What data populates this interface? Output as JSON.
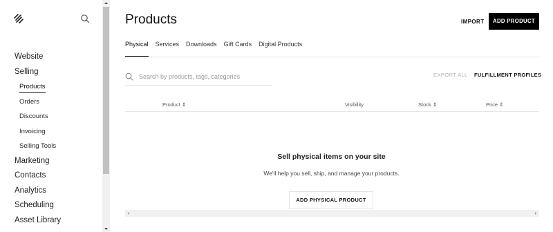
{
  "sidebar": {
    "logo_icon": "squarespace-logo-icon",
    "search_icon": "search-icon",
    "nav": [
      {
        "label": "Website",
        "level": 0
      },
      {
        "label": "Selling",
        "level": 0
      },
      {
        "label": "Products",
        "level": 1,
        "active": true
      },
      {
        "label": "Orders",
        "level": 1
      },
      {
        "label": "Discounts",
        "level": 1
      },
      {
        "label": "Invoicing",
        "level": 1
      },
      {
        "label": "Selling Tools",
        "level": 1
      },
      {
        "label": "Marketing",
        "level": 0
      },
      {
        "label": "Contacts",
        "level": 0
      },
      {
        "label": "Analytics",
        "level": 0
      },
      {
        "label": "Scheduling",
        "level": 0
      },
      {
        "label": "Asset Library",
        "level": 0
      }
    ]
  },
  "header": {
    "title": "Products",
    "import_label": "IMPORT",
    "add_label": "ADD PRODUCT"
  },
  "tabs": [
    {
      "label": "Physical",
      "active": true
    },
    {
      "label": "Services"
    },
    {
      "label": "Downloads"
    },
    {
      "label": "Gift Cards"
    },
    {
      "label": "Digital Products"
    }
  ],
  "toolbar": {
    "search_placeholder": "Search by products, tags, categories",
    "export_label": "EXPORT ALL",
    "fulfillment_label": "FULFILLMENT PROFILES"
  },
  "table": {
    "columns": [
      "Product ⇕",
      "Visibility",
      "Stock ⇕",
      "Price ⇕"
    ]
  },
  "empty_state": {
    "title": "Sell physical items on your site",
    "subtitle": "We'll help you sell, ship, and manage your products.",
    "button_label": "ADD PHYSICAL PRODUCT"
  }
}
